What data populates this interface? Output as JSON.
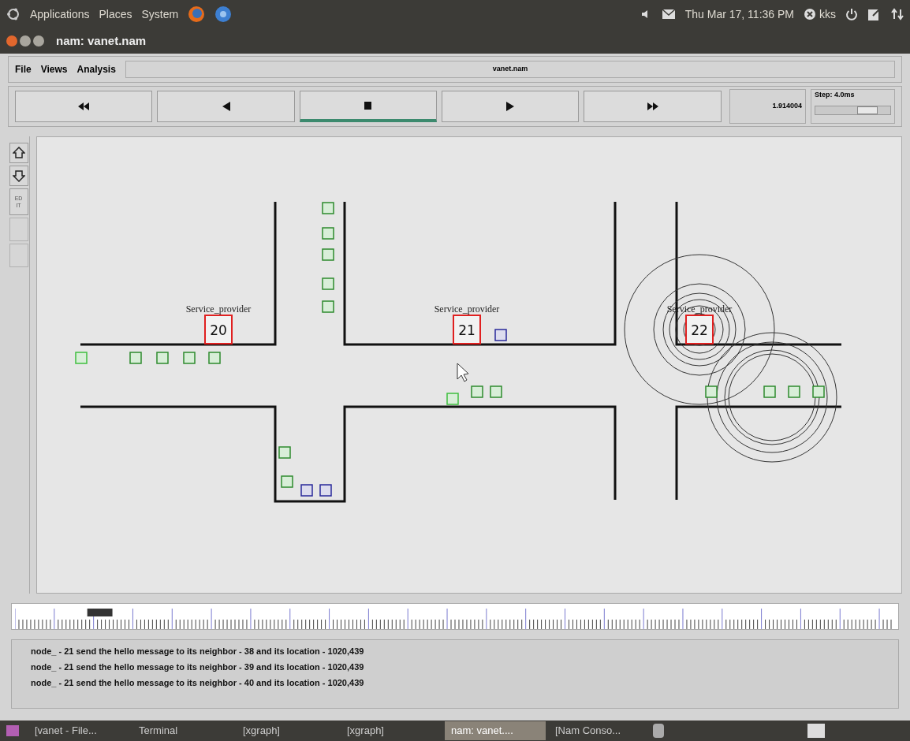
{
  "top_panel": {
    "menus": [
      "Applications",
      "Places",
      "System"
    ],
    "clock": "Thu Mar 17, 11:36 PM",
    "user": "kks"
  },
  "window": {
    "title": "nam: vanet.nam"
  },
  "menu_bar": {
    "items": [
      "File",
      "Views",
      "Analysis"
    ],
    "file_name": "vanet.nam"
  },
  "controls": [
    {
      "kind": "rewind",
      "selected": false
    },
    {
      "kind": "back",
      "selected": false
    },
    {
      "kind": "stop",
      "selected": true
    },
    {
      "kind": "play",
      "selected": false
    },
    {
      "kind": "forward",
      "selected": false
    }
  ],
  "time": "1.914004",
  "step": {
    "label": "Step: 4.0ms",
    "level": 0.7
  },
  "side_tools": [
    {
      "kind": "zoom-in"
    },
    {
      "kind": "zoom-out"
    },
    {
      "kind": "edit",
      "label": "ED\nIT"
    },
    {
      "kind": "blank"
    },
    {
      "kind": "blank"
    }
  ],
  "service_providers": [
    {
      "label": "Service_provider",
      "node": "20"
    },
    {
      "label": "Service_provider",
      "node": "21"
    },
    {
      "label": "Service_provider",
      "node": "22"
    }
  ],
  "log": [
    "node_ - 21 send the hello message to its neighbor - 38 and its location - 1020,439",
    "node_ - 21 send the hello message to its neighbor - 39 and its location - 1020,439",
    "node_ - 21 send the hello message to its neighbor - 40 and its location - 1020,439"
  ],
  "taskbar": [
    {
      "label": "[vanet - File...",
      "selected": false
    },
    {
      "label": "Terminal",
      "selected": false
    },
    {
      "label": "[xgraph]",
      "selected": false
    },
    {
      "label": "[xgraph]",
      "selected": false
    },
    {
      "label": "nam: vanet....",
      "selected": true
    },
    {
      "label": "[Nam Conso...",
      "selected": false
    }
  ]
}
